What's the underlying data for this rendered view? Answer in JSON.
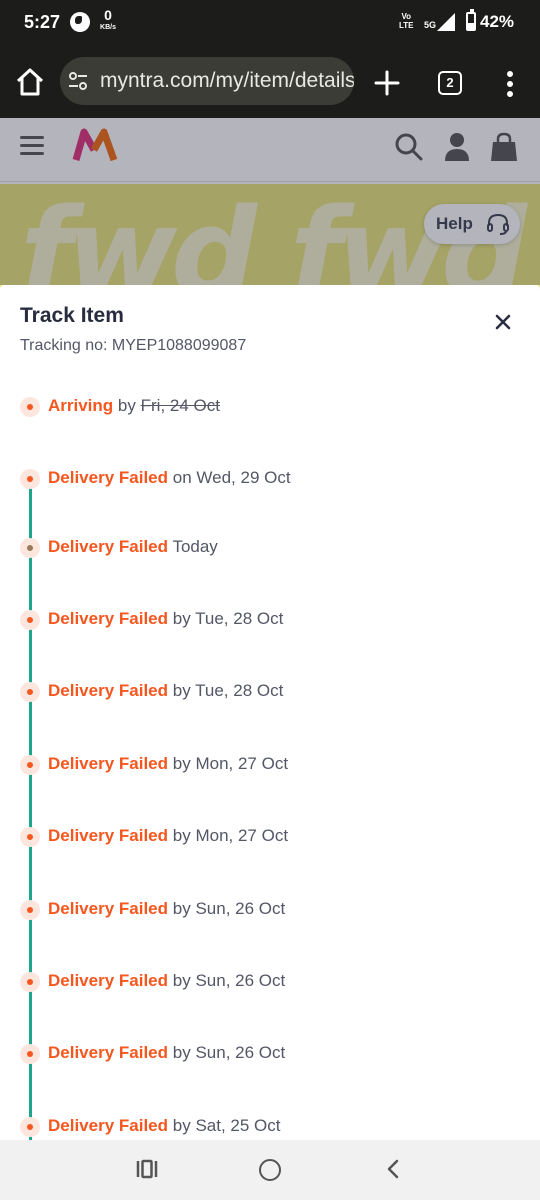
{
  "status_bar": {
    "time": "5:27",
    "speed_value": "0",
    "speed_unit": "KB/s",
    "volte_line1": "Vo",
    "volte_line2": "LTE",
    "network": "5G",
    "battery_percent": "42%",
    "battery_level": 0.42,
    "icons": [
      "globe-icon",
      "signal-icon",
      "battery-icon"
    ]
  },
  "browser": {
    "url": "myntra.com/my/item/details",
    "tab_count": "2",
    "icons": [
      "home-icon",
      "tune-icon",
      "plus-icon",
      "more-vert-icon"
    ]
  },
  "site_header": {
    "icons": [
      "hamburger-icon",
      "myntra-logo",
      "search-icon",
      "profile-icon",
      "bag-icon"
    ]
  },
  "banner": {
    "word_left": "fwd",
    "word_right": "fwd",
    "help_label": "Help"
  },
  "track_sheet": {
    "title": "Track Item",
    "tracking": "Tracking no: MYEP1088099087",
    "events": [
      {
        "status": "Arriving",
        "prefix": "by",
        "date": "Fri, 24 Oct",
        "struck": true
      },
      {
        "status": "Delivery Failed",
        "prefix": "on",
        "date": "Wed, 29 Oct",
        "struck": false
      },
      {
        "status": "Delivery Failed",
        "prefix": "",
        "date": "Today",
        "struck": false
      },
      {
        "status": "Delivery Failed",
        "prefix": "by",
        "date": "Tue, 28 Oct",
        "struck": false
      },
      {
        "status": "Delivery Failed",
        "prefix": "by",
        "date": "Tue, 28 Oct",
        "struck": false
      },
      {
        "status": "Delivery Failed",
        "prefix": "by",
        "date": "Mon, 27 Oct",
        "struck": false
      },
      {
        "status": "Delivery Failed",
        "prefix": "by",
        "date": "Mon, 27 Oct",
        "struck": false
      },
      {
        "status": "Delivery Failed",
        "prefix": "by",
        "date": "Sun, 26 Oct",
        "struck": false
      },
      {
        "status": "Delivery Failed",
        "prefix": "by",
        "date": "Sun, 26 Oct",
        "struck": false
      },
      {
        "status": "Delivery Failed",
        "prefix": "by",
        "date": "Sun, 26 Oct",
        "struck": false
      },
      {
        "status": "Delivery Failed",
        "prefix": "by",
        "date": "Sat, 25 Oct",
        "struck": false
      }
    ]
  },
  "colors": {
    "accent_orange": "#f5571f",
    "timeline_green": "#1fa58a",
    "text_dark": "#282c3f",
    "text_grey": "#535766",
    "banner_yellow": "#e8e47a"
  }
}
